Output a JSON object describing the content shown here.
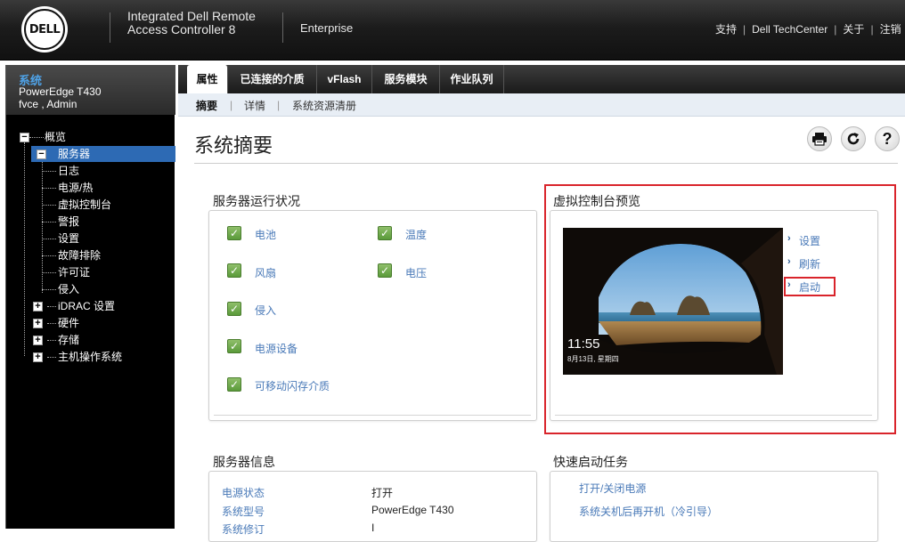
{
  "header": {
    "logo_text": "DELL",
    "product_line1": "Integrated Dell Remote",
    "product_line2": "Access Controller 8",
    "edition": "Enterprise",
    "links": [
      "支持",
      "Dell TechCenter",
      "关于",
      "注销"
    ]
  },
  "sidebar": {
    "title": "系统",
    "model": "PowerEdge T430",
    "user": "fvce , Admin",
    "tree": [
      {
        "label": "概览",
        "expander": "−"
      },
      {
        "label": "服务器",
        "expander": "−",
        "selected": true
      },
      {
        "label": "日志"
      },
      {
        "label": "电源/热"
      },
      {
        "label": "虚拟控制台"
      },
      {
        "label": "警报"
      },
      {
        "label": "设置"
      },
      {
        "label": "故障排除"
      },
      {
        "label": "许可证"
      },
      {
        "label": "侵入"
      },
      {
        "label": "iDRAC 设置",
        "expander": "+"
      },
      {
        "label": "硬件",
        "expander": "+"
      },
      {
        "label": "存储",
        "expander": "+"
      },
      {
        "label": "主机操作系统",
        "expander": "+"
      }
    ]
  },
  "tabs": [
    {
      "label": "属性",
      "active": true
    },
    {
      "label": "已连接的介质"
    },
    {
      "label": "vFlash"
    },
    {
      "label": "服务模块"
    },
    {
      "label": "作业队列"
    }
  ],
  "subtabs": [
    {
      "label": "摘要",
      "active": true
    },
    {
      "label": "详情"
    },
    {
      "label": "系统资源清册"
    }
  ],
  "page_title": "系统摘要",
  "toolbar": {
    "print_icon": "printer-icon",
    "refresh_icon": "refresh-icon",
    "help_label": "?"
  },
  "server_health": {
    "title": "服务器运行状况",
    "items": [
      "电池",
      "温度",
      "风扇",
      "电压",
      "侵入",
      "电源设备",
      "可移动闪存介质"
    ]
  },
  "virtual_console": {
    "title": "虚拟控制台预览",
    "links": [
      "设置",
      "刷新",
      "启动"
    ],
    "screen_time": "11:55",
    "screen_date": "8月13日, 星期四"
  },
  "server_info": {
    "title": "服务器信息",
    "rows": [
      {
        "key": "电源状态",
        "value": "打开"
      },
      {
        "key": "系统型号",
        "value": "PowerEdge T430"
      },
      {
        "key": "系统修订",
        "value": "I"
      }
    ]
  },
  "quick_launch": {
    "title": "快速启动任务",
    "links": [
      "打开/关闭电源",
      "系统关机后再开机（冷引导）"
    ]
  },
  "colors": {
    "accent_blue": "#4a7ab8",
    "selection": "#2d6ab4",
    "highlight_red": "#d9242b",
    "status_ok_green": "#5a9a3a"
  }
}
